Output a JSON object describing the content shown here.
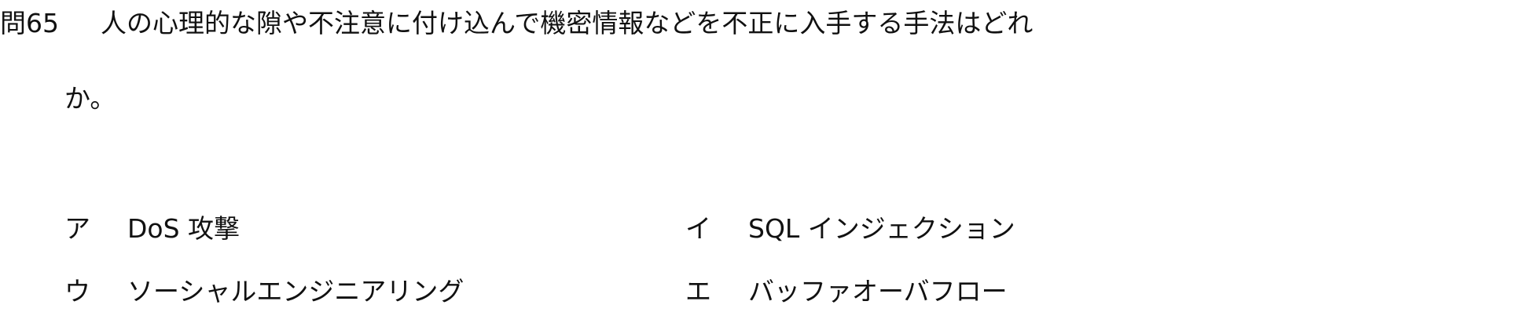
{
  "question": {
    "number": "問65",
    "text_line1": "人の心理的な隙や不注意に付け込んで機密情報などを不正に入手する手法はどれ",
    "text_line2": "か。"
  },
  "choices": [
    {
      "letter": "ア",
      "text": "DoS 攻撃"
    },
    {
      "letter": "イ",
      "text": "SQL インジェクション"
    },
    {
      "letter": "ウ",
      "text": "ソーシャルエンジニアリング"
    },
    {
      "letter": "エ",
      "text": "バッファオーバフロー"
    }
  ]
}
